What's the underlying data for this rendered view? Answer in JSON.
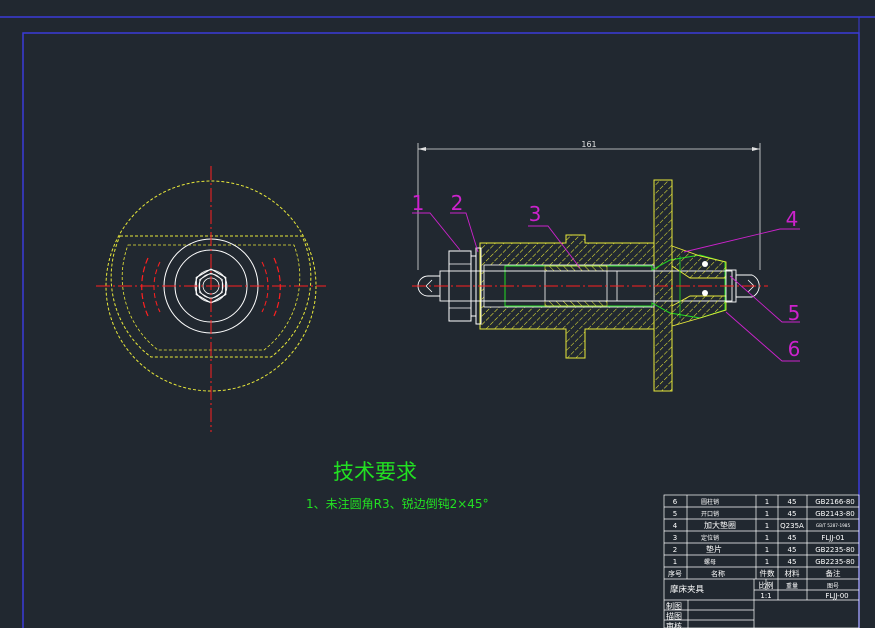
{
  "colors": {
    "background": "#212830",
    "frame": "#2a2ad0",
    "outline": "#ffffff",
    "hatch": "#e8e83a",
    "centerline": "#ff2020",
    "leader": "#cc22cc",
    "title_text": "#22e022",
    "green_part": "#22dd22",
    "dimension": "#e0e0e0"
  },
  "dimension": {
    "length": "161"
  },
  "balloons": [
    "1",
    "2",
    "3",
    "4",
    "5",
    "6"
  ],
  "tech": {
    "title": "技术要求",
    "note": "1、未注圆角R3、锐边倒钝2×45°"
  },
  "bom": {
    "rows": [
      {
        "no": "6",
        "name": "圆柱销",
        "qty": "1",
        "material": "45",
        "note": "GB2166-80"
      },
      {
        "no": "5",
        "name": "开口销",
        "qty": "1",
        "material": "45",
        "note": "GB2143-80"
      },
      {
        "no": "4",
        "name": "加大垫圈",
        "qty": "1",
        "material": "Q235A",
        "note": "GB/T 5287-1985"
      },
      {
        "no": "3",
        "name": "定位销",
        "qty": "1",
        "material": "45",
        "note": "FLJJ-01"
      },
      {
        "no": "2",
        "name": "垫片",
        "qty": "1",
        "material": "45",
        "note": "GB2235-80"
      },
      {
        "no": "1",
        "name": "螺母",
        "qty": "1",
        "material": "45",
        "note": "GB2235-80"
      }
    ],
    "header": {
      "no": "序号",
      "name": "名称",
      "qty": "件数",
      "material": "材料",
      "note": "备注"
    },
    "title": "摩床夹具",
    "scale_label": "比例",
    "scale": "1:1",
    "weight_label": "重量",
    "sheet_label": "图号",
    "drawing_no": "FLJJ-00",
    "signatures": [
      "制图",
      "描图",
      "审核"
    ]
  }
}
